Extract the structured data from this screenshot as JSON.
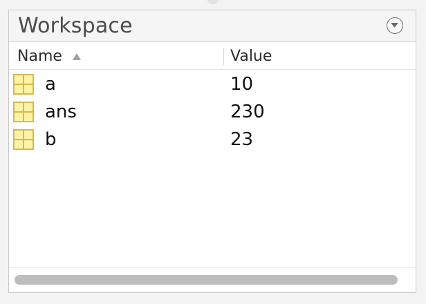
{
  "workspace": {
    "title": "Workspace",
    "menu_icon": "circle-chevron-down-icon",
    "columns": {
      "name": "Name",
      "value": "Value",
      "sort_icon": "sort-ascending-icon"
    },
    "variables": [
      {
        "name": "a",
        "value": "10",
        "icon": "matrix-variable-icon"
      },
      {
        "name": "ans",
        "value": "230",
        "icon": "matrix-variable-icon"
      },
      {
        "name": "b",
        "value": "23",
        "icon": "matrix-variable-icon"
      }
    ]
  },
  "colors": {
    "icon_fill": "#fff3a8",
    "icon_border": "#d8b848",
    "scroll_thumb": "#bdbdbd"
  }
}
